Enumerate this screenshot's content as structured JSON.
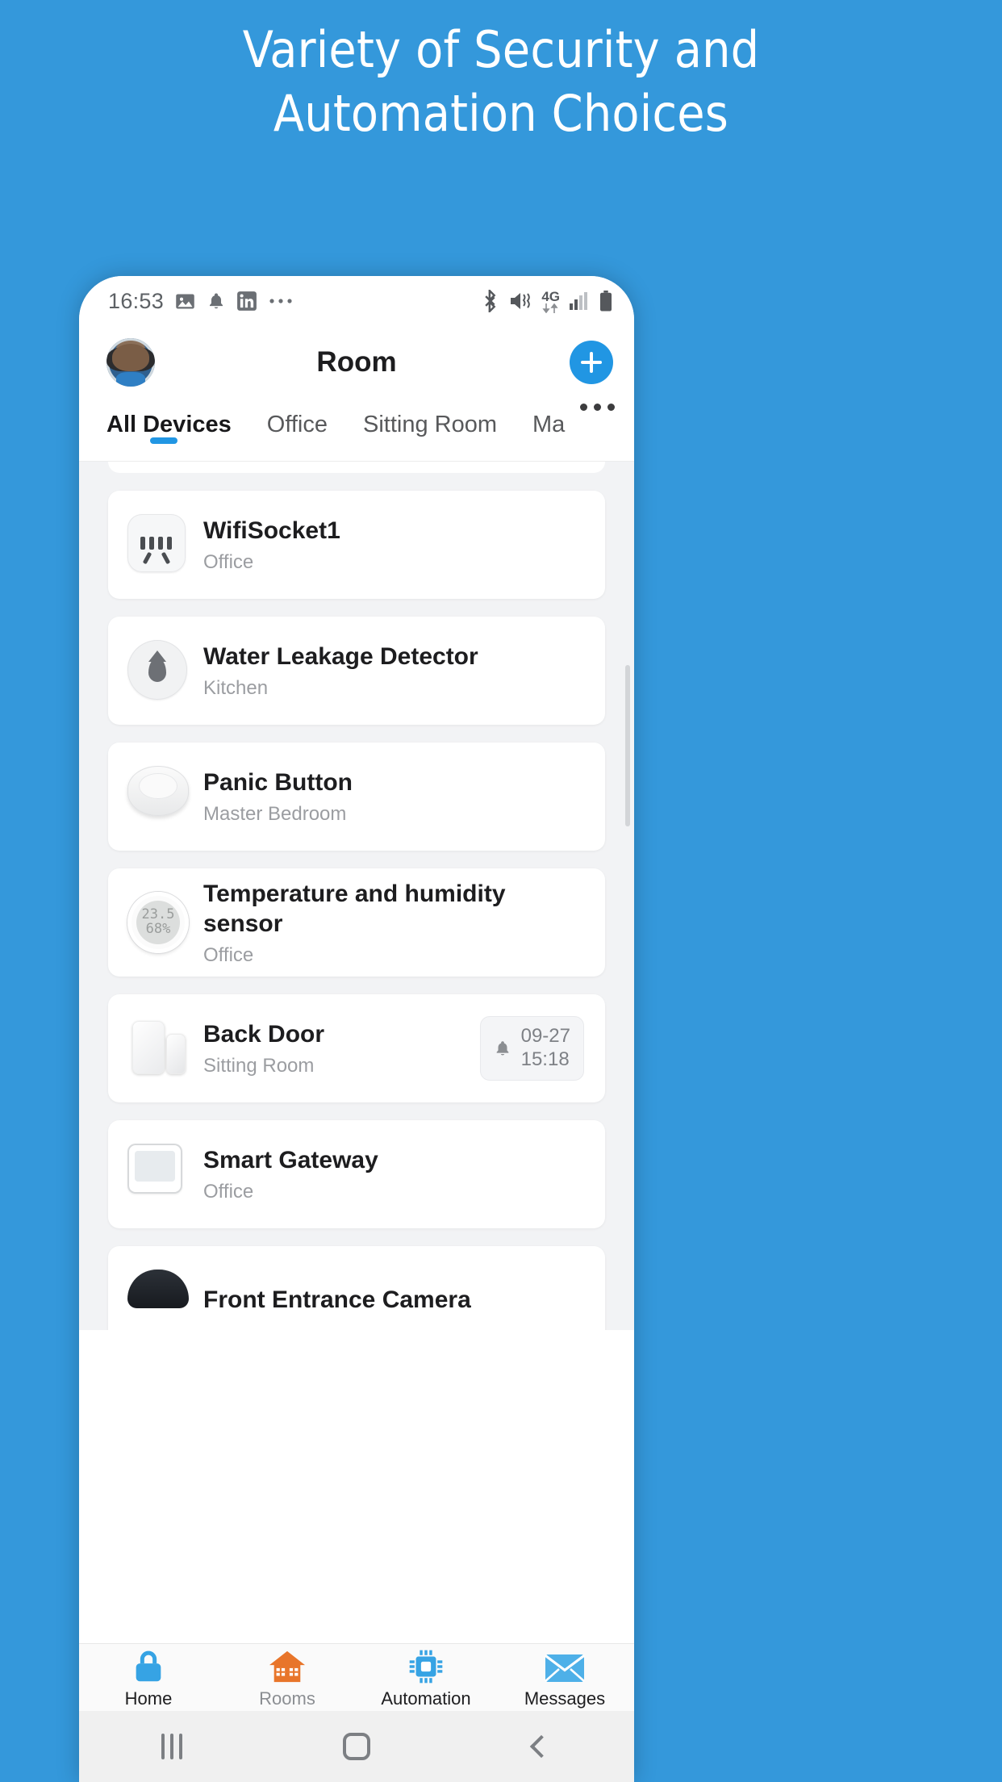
{
  "promo": {
    "line1": "Variety of Security and",
    "line2": "Automation Choices"
  },
  "colors": {
    "background": "#3498db",
    "accent": "#2196e3",
    "rooms_accent": "#e8752a",
    "card": "#ffffff",
    "list_background": "#f2f3f5"
  },
  "statusbar": {
    "time": "16:53",
    "left_icons": [
      "image-icon",
      "bell-icon",
      "linkedin-icon",
      "more-icon"
    ],
    "network_label": "4G",
    "right_icons": [
      "bluetooth-icon",
      "vibrate-icon",
      "signal-icon",
      "battery-icon"
    ]
  },
  "appbar": {
    "title": "Room",
    "avatar": "user-avatar",
    "add_label": "+"
  },
  "tabs": [
    {
      "label": "All Devices",
      "active": true
    },
    {
      "label": "Office",
      "active": false
    },
    {
      "label": "Sitting Room",
      "active": false
    },
    {
      "label": "Mas",
      "active": false
    },
    {
      "label": "...",
      "active": false
    }
  ],
  "devices": [
    {
      "name": "WifiSocket1",
      "room": "Office",
      "icon": "wifi-socket-icon"
    },
    {
      "name": "Water Leakage Detector",
      "room": "Kitchen",
      "icon": "water-drop-icon"
    },
    {
      "name": "Panic Button",
      "room": "Master Bedroom",
      "icon": "panic-button-icon"
    },
    {
      "name": "Temperature and humidity sensor",
      "room": "Office",
      "icon": "thermometer-icon",
      "lcd_top": "23.5",
      "lcd_bottom": "68%"
    },
    {
      "name": "Back Door",
      "room": "Sitting Room",
      "icon": "door-contact-icon",
      "badge": {
        "date": "09-27",
        "time": "15:18",
        "icon": "bell-icon"
      }
    },
    {
      "name": "Smart Gateway",
      "room": "Office",
      "icon": "gateway-icon"
    },
    {
      "name": "Front Entrance Camera",
      "room": "",
      "icon": "camera-icon"
    }
  ],
  "bottomnav": [
    {
      "label": "Home",
      "icon": "lock-icon",
      "active": true
    },
    {
      "label": "Rooms",
      "icon": "house-icon",
      "active": false
    },
    {
      "label": "Automation",
      "icon": "chip-icon",
      "active": false
    },
    {
      "label": "Messages",
      "icon": "envelope-icon",
      "active": false
    }
  ],
  "androidnav": [
    {
      "label": "recents-button",
      "icon": "recents-icon"
    },
    {
      "label": "home-button",
      "icon": "home-circle-icon"
    },
    {
      "label": "back-button",
      "icon": "back-arrow-icon"
    }
  ]
}
